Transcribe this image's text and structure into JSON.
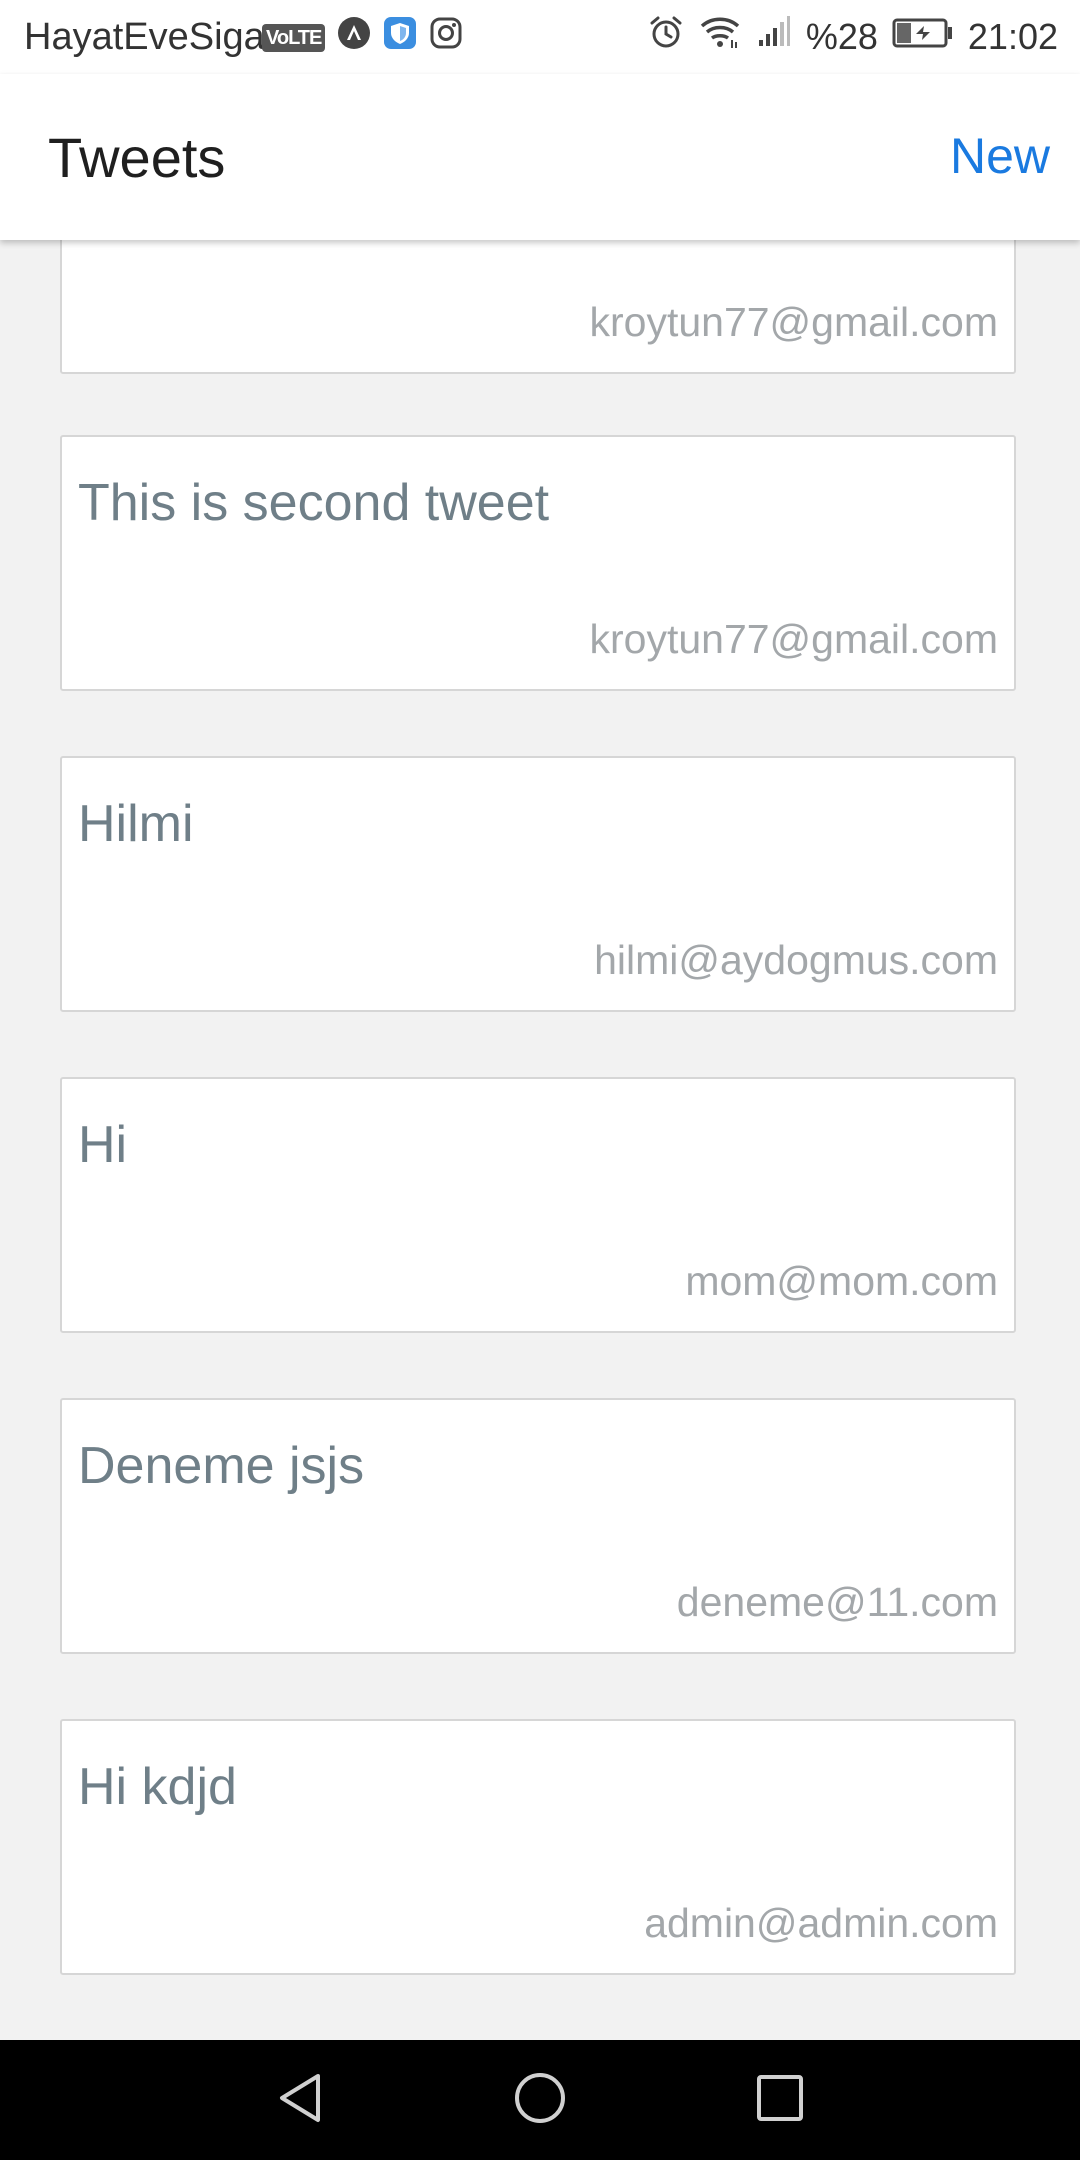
{
  "status_bar": {
    "carrier": "HayatEveSigar",
    "volte": "VoLTE",
    "battery_percent": "%28",
    "time": "21:02",
    "icons": [
      "volte-icon",
      "autonavi-icon",
      "shield-icon",
      "instagram-icon",
      "alarm-icon",
      "wifi-icon",
      "signal-icon",
      "battery-charging-icon"
    ]
  },
  "header": {
    "title": "Tweets",
    "new_label": "New"
  },
  "tweets": [
    {
      "text": "",
      "email": "kroytun77@gmail.com"
    },
    {
      "text": "This is second tweet",
      "email": "kroytun77@gmail.com"
    },
    {
      "text": "Hilmi",
      "email": "hilmi@aydogmus.com"
    },
    {
      "text": "Hi",
      "email": "mom@mom.com"
    },
    {
      "text": "Deneme jsjs",
      "email": "deneme@11.com"
    },
    {
      "text": "Hi kdjd",
      "email": "admin@admin.com"
    }
  ],
  "nav_bar": {
    "icons": [
      "back-icon",
      "home-icon",
      "recents-icon"
    ]
  },
  "colors": {
    "accent": "#1a7ae0",
    "tweet_text": "#6f7f88",
    "email_text": "#a3a7aa",
    "background": "#f2f2f2"
  }
}
